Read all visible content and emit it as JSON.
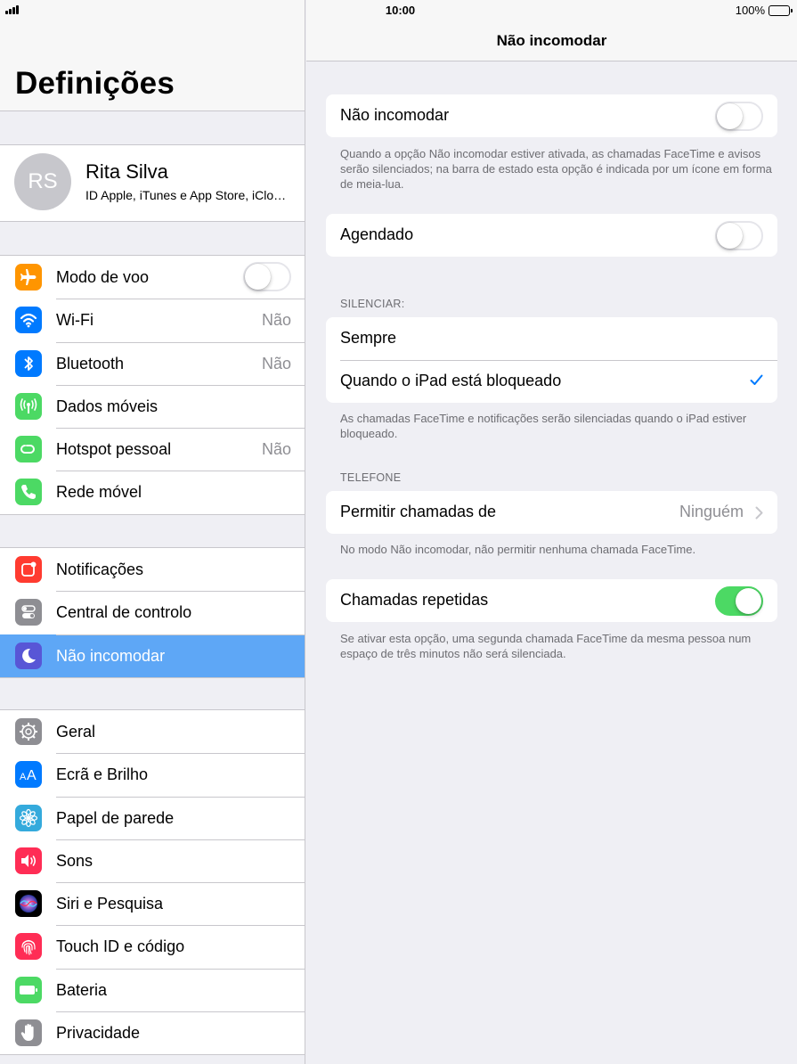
{
  "status_bar": {
    "time": "10:00",
    "battery_percent": "100%",
    "battery_level": 1.0,
    "signal_bars": 4
  },
  "sidebar": {
    "title": "Definições",
    "profile": {
      "initials": "RS",
      "name": "Rita Silva",
      "subtitle": "ID Apple, iTunes e App Store, iCloud..."
    },
    "group1": [
      {
        "label": "Modo de voo",
        "icon": "airplane-icon",
        "color": "#ff9500",
        "toggle": false
      },
      {
        "label": "Wi-Fi",
        "icon": "wifi-icon",
        "color": "#007aff",
        "value": "Não"
      },
      {
        "label": "Bluetooth",
        "icon": "bluetooth-icon",
        "color": "#007aff",
        "value": "Não"
      },
      {
        "label": "Dados móveis",
        "icon": "antenna-icon",
        "color": "#4cd964"
      },
      {
        "label": "Hotspot pessoal",
        "icon": "hotspot-icon",
        "color": "#4cd964",
        "value": "Não"
      },
      {
        "label": "Rede móvel",
        "icon": "phone-icon",
        "color": "#4cd964"
      }
    ],
    "group2": [
      {
        "label": "Notificações",
        "icon": "notifications-icon",
        "color": "#ff3b30"
      },
      {
        "label": "Central de controlo",
        "icon": "control-center-icon",
        "color": "#8e8e93"
      },
      {
        "label": "Não incomodar",
        "icon": "moon-icon",
        "color": "#5856d6",
        "selected": true
      }
    ],
    "group3": [
      {
        "label": "Geral",
        "icon": "gear-icon",
        "color": "#8e8e93"
      },
      {
        "label": "Ecrã e Brilho",
        "icon": "text-size-icon",
        "color": "#007aff"
      },
      {
        "label": "Papel de parede",
        "icon": "wallpaper-icon",
        "color": "#34aadc"
      },
      {
        "label": "Sons",
        "icon": "speaker-icon",
        "color": "#ff2d55"
      },
      {
        "label": "Siri e Pesquisa",
        "icon": "siri-icon",
        "color": "#000000"
      },
      {
        "label": "Touch ID e código",
        "icon": "fingerprint-icon",
        "color": "#ff2d55"
      },
      {
        "label": "Bateria",
        "icon": "battery-icon",
        "color": "#4cd964"
      },
      {
        "label": "Privacidade",
        "icon": "hand-icon",
        "color": "#8e8e93"
      }
    ]
  },
  "detail": {
    "title": "Não incomodar",
    "dnd": {
      "label": "Não incomodar",
      "toggle": false
    },
    "dnd_footer": "Quando a opção Não incomodar estiver ativada, as chamadas FaceTime e avisos serão silenciados; na barra de estado esta opção é indicada por um ícone em forma de meia-lua.",
    "scheduled": {
      "label": "Agendado",
      "toggle": false
    },
    "silence_header": "SILENCIAR:",
    "silence_options": [
      {
        "label": "Sempre",
        "checked": false
      },
      {
        "label": "Quando o iPad está bloqueado",
        "checked": true
      }
    ],
    "silence_footer": "As chamadas FaceTime e notificações serão silenciadas quando o iPad estiver bloqueado.",
    "phone_header": "TELEFONE",
    "allow_calls": {
      "label": "Permitir chamadas de",
      "value": "Ninguém"
    },
    "allow_footer": "No modo Não incomodar, não permitir nenhuma chamada FaceTime.",
    "repeated": {
      "label": "Chamadas repetidas",
      "toggle": true
    },
    "repeated_footer": "Se ativar esta opção, uma segunda chamada FaceTime da mesma pessoa num espaço de três minutos não será silenciada.",
    "accent_color": "#007aff",
    "toggle_on_color": "#4cd964"
  }
}
